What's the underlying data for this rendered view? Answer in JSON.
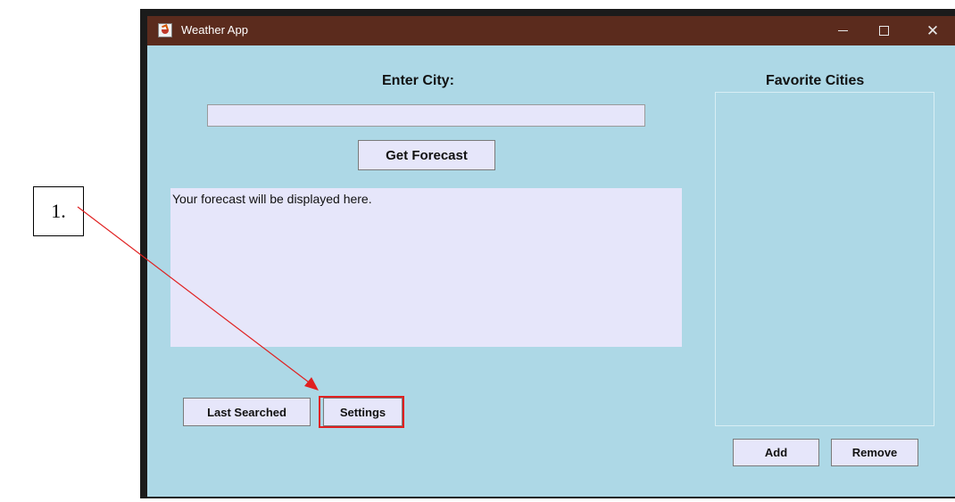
{
  "window": {
    "title": "Weather App",
    "controls": {
      "minimize": "—",
      "maximize": "☐",
      "close": "✕"
    }
  },
  "main": {
    "city_label": "Enter City:",
    "city_input": {
      "value": "",
      "placeholder": ""
    },
    "get_forecast_label": "Get Forecast",
    "forecast_text": "Your forecast will be displayed here.",
    "last_searched_label": "Last Searched",
    "settings_label": "Settings"
  },
  "favorites": {
    "title": "Favorite Cities",
    "items": [],
    "add_label": "Add",
    "remove_label": "Remove"
  },
  "annotation": {
    "callout_label": "1.",
    "highlight_color": "#e02020"
  },
  "colors": {
    "titlebar": "#5b2b1d",
    "background": "#add8e6",
    "field": "#e6e6fa"
  }
}
